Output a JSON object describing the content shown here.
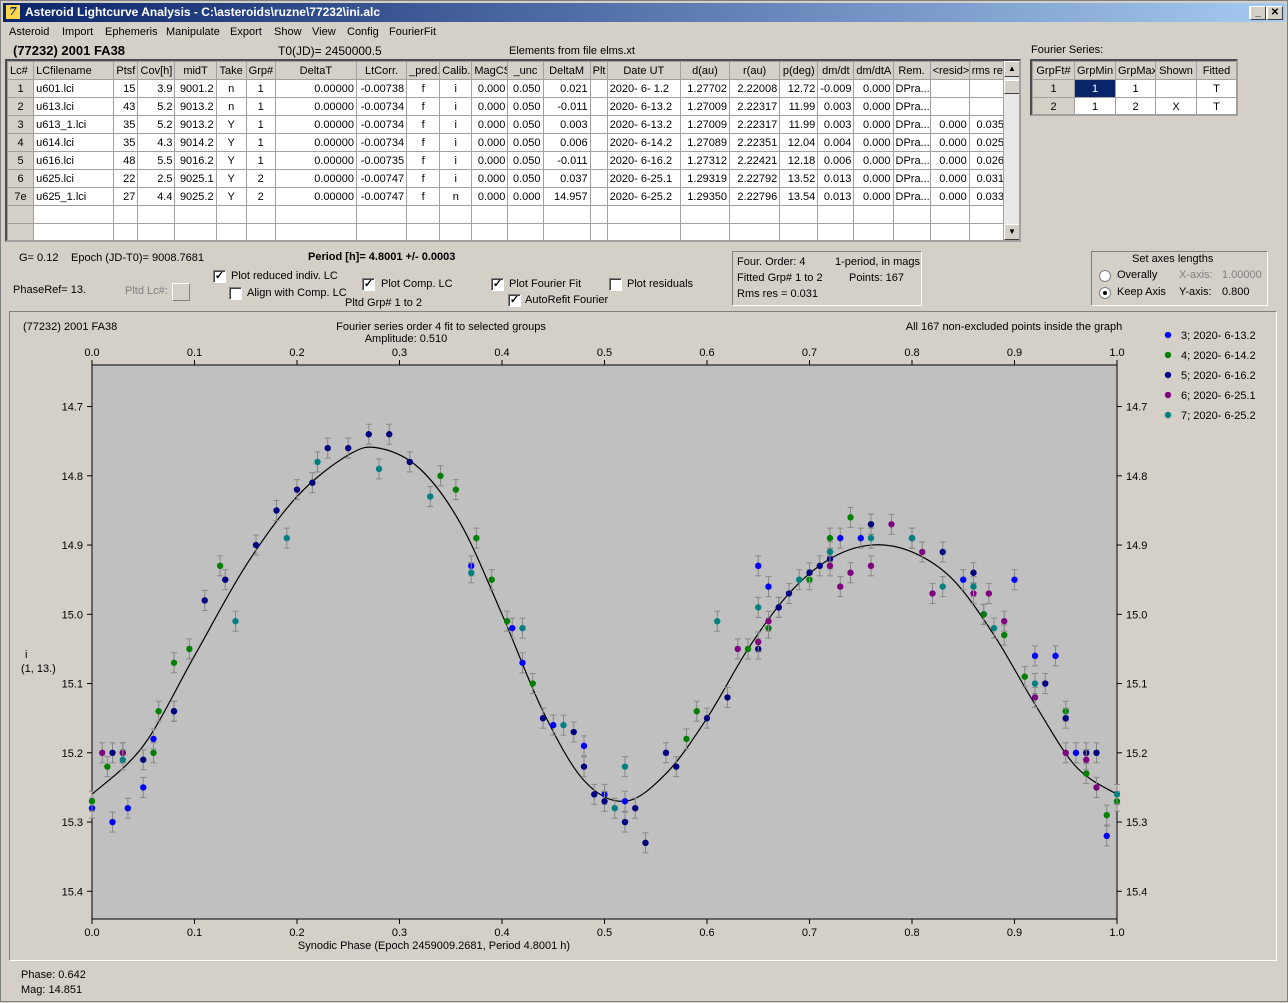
{
  "window": {
    "title": "Asteroid Lightcurve Analysis - C:\\asteroids\\ruzne\\77232\\ini.alc",
    "icon_glyph": "7"
  },
  "menu": [
    "Asteroid",
    "Import",
    "Ephemeris",
    "Manipulate",
    "Export",
    "Show",
    "View",
    "Config",
    "FourierFit"
  ],
  "header": {
    "object": "(77232) 2001 FA38",
    "t0": "T0(JD)= 2450000.5",
    "elements": "Elements from file elms.xt",
    "fourier_series_label": "Fourier Series:"
  },
  "lc_table": {
    "columns": [
      "Lc#",
      "LCfilename",
      "Ptsf",
      "Cov[h]",
      "midT",
      "Take",
      "Grp#",
      "DeltaT",
      "LtCorr.",
      "_pred.",
      "Calib.",
      "MagCS",
      "_unc",
      "DeltaM",
      "Plt",
      "Date UT",
      "d(au)",
      "r(au)",
      "p(deg)",
      "dm/dt",
      "dm/dtA",
      "Rem.",
      "<resid>",
      "rms res"
    ],
    "rows": [
      [
        "1",
        "u601.lci",
        "15",
        "3.9",
        "9001.2",
        "n",
        "1",
        "0.00000",
        "-0.00738",
        "f",
        "i",
        "0.000",
        "0.050",
        "0.021",
        "",
        "2020- 6- 1.2",
        "1.27702",
        "2.22008",
        "12.72",
        "-0.009",
        "0.000",
        "DPra...",
        "",
        ""
      ],
      [
        "2",
        "u613.lci",
        "43",
        "5.2",
        "9013.2",
        "n",
        "1",
        "0.00000",
        "-0.00734",
        "f",
        "i",
        "0.000",
        "0.050",
        "-0.011",
        "",
        "2020- 6-13.2",
        "1.27009",
        "2.22317",
        "11.99",
        "0.003",
        "0.000",
        "DPra...",
        "",
        ""
      ],
      [
        "3",
        "u613_1.lci",
        "35",
        "5.2",
        "9013.2",
        "Y",
        "1",
        "0.00000",
        "-0.00734",
        "f",
        "i",
        "0.000",
        "0.050",
        "0.003",
        "",
        "2020- 6-13.2",
        "1.27009",
        "2.22317",
        "11.99",
        "0.003",
        "0.000",
        "DPra...",
        "0.000",
        "0.035"
      ],
      [
        "4",
        "u614.lci",
        "35",
        "4.3",
        "9014.2",
        "Y",
        "1",
        "0.00000",
        "-0.00734",
        "f",
        "i",
        "0.000",
        "0.050",
        "0.006",
        "",
        "2020- 6-14.2",
        "1.27089",
        "2.22351",
        "12.04",
        "0.004",
        "0.000",
        "DPra...",
        "0.000",
        "0.025"
      ],
      [
        "5",
        "u616.lci",
        "48",
        "5.5",
        "9016.2",
        "Y",
        "1",
        "0.00000",
        "-0.00735",
        "f",
        "i",
        "0.000",
        "0.050",
        "-0.011",
        "",
        "2020- 6-16.2",
        "1.27312",
        "2.22421",
        "12.18",
        "0.006",
        "0.000",
        "DPra...",
        "0.000",
        "0.026"
      ],
      [
        "6",
        "u625.lci",
        "22",
        "2.5",
        "9025.1",
        "Y",
        "2",
        "0.00000",
        "-0.00747",
        "f",
        "i",
        "0.000",
        "0.050",
        "0.037",
        "",
        "2020- 6-25.1",
        "1.29319",
        "2.22792",
        "13.52",
        "0.013",
        "0.000",
        "DPra...",
        "0.000",
        "0.031"
      ],
      [
        "7e",
        "u625_1.lci",
        "27",
        "4.4",
        "9025.2",
        "Y",
        "2",
        "0.00000",
        "-0.00747",
        "f",
        "n",
        "0.000",
        "0.000",
        "14.957",
        "",
        "2020- 6-25.2",
        "1.29350",
        "2.22796",
        "13.54",
        "0.013",
        "0.000",
        "DPra...",
        "0.000",
        "0.033"
      ]
    ]
  },
  "fourier_table": {
    "columns": [
      "GrpFt#",
      "GrpMin",
      "GrpMax",
      "Shown",
      "Fitted"
    ],
    "rows": [
      [
        "1",
        "1",
        "1",
        "",
        "T"
      ],
      [
        "2",
        "1",
        "2",
        "X",
        "T"
      ]
    ]
  },
  "info": {
    "g": "G= 0.12",
    "epoch": "Epoch (JD-T0)= 9008.7681",
    "period": "Period [h]= 4.8001 +/- 0.0003",
    "phaseref": "PhaseRef= 13.",
    "pltd_lc": "Pltd Lc#:",
    "plot_reduced": "Plot reduced indiv. LC",
    "align": "Align with Comp. LC",
    "plot_comp": "Plot Comp. LC",
    "pltd_grp": "Pltd Grp#  1   to   2",
    "plot_fourier": "Plot Fourier Fit",
    "autorefit": "AutoRefit Fourier",
    "plot_resid": "Plot residuals",
    "four_order": "Four. Order:  4",
    "one_period": "1-period, in mags",
    "fitted_grp": "Fitted Grp# 1 to 2",
    "points": "Points: 167",
    "rms": "Rms res      = 0.031",
    "axes_title": "Set axes lengths",
    "overally": "Overally",
    "keep_axis": "Keep Axis",
    "xaxis_lbl": "X-axis:",
    "xaxis_val": "1.00000",
    "yaxis_lbl": "Y-axis:",
    "yaxis_val": "0.800"
  },
  "status": {
    "phase": "Phase:  0.642",
    "mag": "Mag:    14.851"
  },
  "chart_data": {
    "type": "scatter",
    "title": "(77232) 2001 FA38",
    "subtitle": "Fourier series order 4 fit to selected groups",
    "amplitude": "Amplitude: 0.510",
    "note": "All 167 non-excluded points inside the graph",
    "xlabel": "Synodic Phase (Epoch 2459009.2681, Period 4.8001 h)",
    "ylabel": "i",
    "ylabel2": "(1, 13.)",
    "xlim": [
      0,
      1
    ],
    "ylim": [
      15.44,
      14.64
    ],
    "xticks": [
      0,
      0.1,
      0.2,
      0.3,
      0.4,
      0.5,
      0.6,
      0.7,
      0.8,
      0.9,
      1.0
    ],
    "xtick_labels": [
      "0.0",
      "0.1",
      "0.2",
      "0.3",
      "0.4",
      "0.5",
      "0.6",
      "0.7",
      "0.8",
      "0.9",
      "1.0"
    ],
    "yticks": [
      14.7,
      14.8,
      14.9,
      15.0,
      15.1,
      15.2,
      15.3,
      15.4
    ],
    "ytick_labels": [
      "14.7",
      "14.8",
      "14.9",
      "15.0",
      "15.1",
      "15.2",
      "15.3",
      "15.4"
    ],
    "fourier_curve": {
      "x": [
        0,
        0.05,
        0.1,
        0.15,
        0.2,
        0.25,
        0.28,
        0.32,
        0.36,
        0.4,
        0.44,
        0.48,
        0.52,
        0.56,
        0.6,
        0.64,
        0.68,
        0.72,
        0.76,
        0.8,
        0.84,
        0.88,
        0.92,
        0.96,
        1.0
      ],
      "y": [
        15.26,
        15.19,
        15.06,
        14.93,
        14.83,
        14.77,
        14.76,
        14.79,
        14.87,
        15.0,
        15.14,
        15.24,
        15.27,
        15.23,
        15.15,
        15.05,
        14.97,
        14.92,
        14.9,
        14.91,
        14.95,
        15.03,
        15.13,
        15.22,
        15.26
      ]
    },
    "series": [
      {
        "name": "3; 2020- 6-13.2",
        "color": "#0000ff",
        "points": [
          [
            0.0,
            15.28
          ],
          [
            0.02,
            15.3
          ],
          [
            0.035,
            15.28
          ],
          [
            0.05,
            15.25
          ],
          [
            0.06,
            15.18
          ],
          [
            0.08,
            15.14
          ],
          [
            0.37,
            14.93
          ],
          [
            0.41,
            15.02
          ],
          [
            0.42,
            15.07
          ],
          [
            0.45,
            15.16
          ],
          [
            0.48,
            15.19
          ],
          [
            0.5,
            15.26
          ],
          [
            0.52,
            15.27
          ],
          [
            0.65,
            14.93
          ],
          [
            0.66,
            14.96
          ],
          [
            0.67,
            14.99
          ],
          [
            0.73,
            14.89
          ],
          [
            0.75,
            14.89
          ],
          [
            0.85,
            14.95
          ],
          [
            0.87,
            15.0
          ],
          [
            0.9,
            14.95
          ],
          [
            0.92,
            15.06
          ],
          [
            0.94,
            15.06
          ],
          [
            0.96,
            15.2
          ],
          [
            0.99,
            15.32
          ]
        ]
      },
      {
        "name": "4; 2020- 6-14.2",
        "color": "#008000",
        "points": [
          [
            0.0,
            15.27
          ],
          [
            0.015,
            15.22
          ],
          [
            0.03,
            15.2
          ],
          [
            0.06,
            15.2
          ],
          [
            0.065,
            15.14
          ],
          [
            0.08,
            15.07
          ],
          [
            0.095,
            15.05
          ],
          [
            0.125,
            14.93
          ],
          [
            0.34,
            14.8
          ],
          [
            0.355,
            14.82
          ],
          [
            0.375,
            14.89
          ],
          [
            0.39,
            14.95
          ],
          [
            0.405,
            15.01
          ],
          [
            0.43,
            15.1
          ],
          [
            0.58,
            15.18
          ],
          [
            0.59,
            15.14
          ],
          [
            0.64,
            15.05
          ],
          [
            0.66,
            15.02
          ],
          [
            0.7,
            14.95
          ],
          [
            0.72,
            14.89
          ],
          [
            0.74,
            14.86
          ],
          [
            0.76,
            14.87
          ],
          [
            0.87,
            15.0
          ],
          [
            0.89,
            15.03
          ],
          [
            0.91,
            15.09
          ],
          [
            0.95,
            15.14
          ],
          [
            0.97,
            15.23
          ],
          [
            0.99,
            15.29
          ],
          [
            1.0,
            15.27
          ]
        ]
      },
      {
        "name": "5; 2020- 6-16.2",
        "color": "#000080",
        "points": [
          [
            0.02,
            15.2
          ],
          [
            0.05,
            15.21
          ],
          [
            0.08,
            15.14
          ],
          [
            0.11,
            14.98
          ],
          [
            0.13,
            14.95
          ],
          [
            0.16,
            14.9
          ],
          [
            0.18,
            14.85
          ],
          [
            0.2,
            14.82
          ],
          [
            0.215,
            14.81
          ],
          [
            0.23,
            14.76
          ],
          [
            0.25,
            14.76
          ],
          [
            0.27,
            14.74
          ],
          [
            0.29,
            14.74
          ],
          [
            0.31,
            14.78
          ],
          [
            0.44,
            15.15
          ],
          [
            0.47,
            15.17
          ],
          [
            0.48,
            15.22
          ],
          [
            0.49,
            15.26
          ],
          [
            0.5,
            15.27
          ],
          [
            0.52,
            15.3
          ],
          [
            0.53,
            15.28
          ],
          [
            0.54,
            15.33
          ],
          [
            0.56,
            15.2
          ],
          [
            0.57,
            15.22
          ],
          [
            0.6,
            15.15
          ],
          [
            0.62,
            15.12
          ],
          [
            0.65,
            15.05
          ],
          [
            0.67,
            14.99
          ],
          [
            0.68,
            14.97
          ],
          [
            0.7,
            14.94
          ],
          [
            0.71,
            14.93
          ],
          [
            0.72,
            14.92
          ],
          [
            0.76,
            14.87
          ],
          [
            0.8,
            14.89
          ],
          [
            0.83,
            14.91
          ],
          [
            0.86,
            14.94
          ],
          [
            0.93,
            15.1
          ],
          [
            0.95,
            15.15
          ],
          [
            0.97,
            15.2
          ],
          [
            0.98,
            15.2
          ]
        ]
      },
      {
        "name": "6; 2020- 6-25.1",
        "color": "#800080",
        "points": [
          [
            0.01,
            15.2
          ],
          [
            0.03,
            15.2
          ],
          [
            0.63,
            15.05
          ],
          [
            0.65,
            15.04
          ],
          [
            0.66,
            15.01
          ],
          [
            0.72,
            14.93
          ],
          [
            0.73,
            14.96
          ],
          [
            0.74,
            14.94
          ],
          [
            0.76,
            14.93
          ],
          [
            0.78,
            14.87
          ],
          [
            0.81,
            14.91
          ],
          [
            0.82,
            14.97
          ],
          [
            0.86,
            14.97
          ],
          [
            0.875,
            14.97
          ],
          [
            0.89,
            15.01
          ],
          [
            0.92,
            15.12
          ],
          [
            0.95,
            15.2
          ],
          [
            0.97,
            15.21
          ],
          [
            0.98,
            15.25
          ]
        ]
      },
      {
        "name": "7; 2020- 6-25.2",
        "color": "#008080",
        "points": [
          [
            0.03,
            15.21
          ],
          [
            0.14,
            15.01
          ],
          [
            0.19,
            14.89
          ],
          [
            0.22,
            14.78
          ],
          [
            0.28,
            14.79
          ],
          [
            0.33,
            14.83
          ],
          [
            0.37,
            14.94
          ],
          [
            0.42,
            15.02
          ],
          [
            0.46,
            15.16
          ],
          [
            0.51,
            15.28
          ],
          [
            0.52,
            15.22
          ],
          [
            0.61,
            15.01
          ],
          [
            0.65,
            14.99
          ],
          [
            0.69,
            14.95
          ],
          [
            0.72,
            14.91
          ],
          [
            0.76,
            14.89
          ],
          [
            0.8,
            14.89
          ],
          [
            0.83,
            14.96
          ],
          [
            0.86,
            14.96
          ],
          [
            0.88,
            15.02
          ],
          [
            0.92,
            15.1
          ],
          [
            1.0,
            15.26
          ]
        ]
      }
    ]
  }
}
